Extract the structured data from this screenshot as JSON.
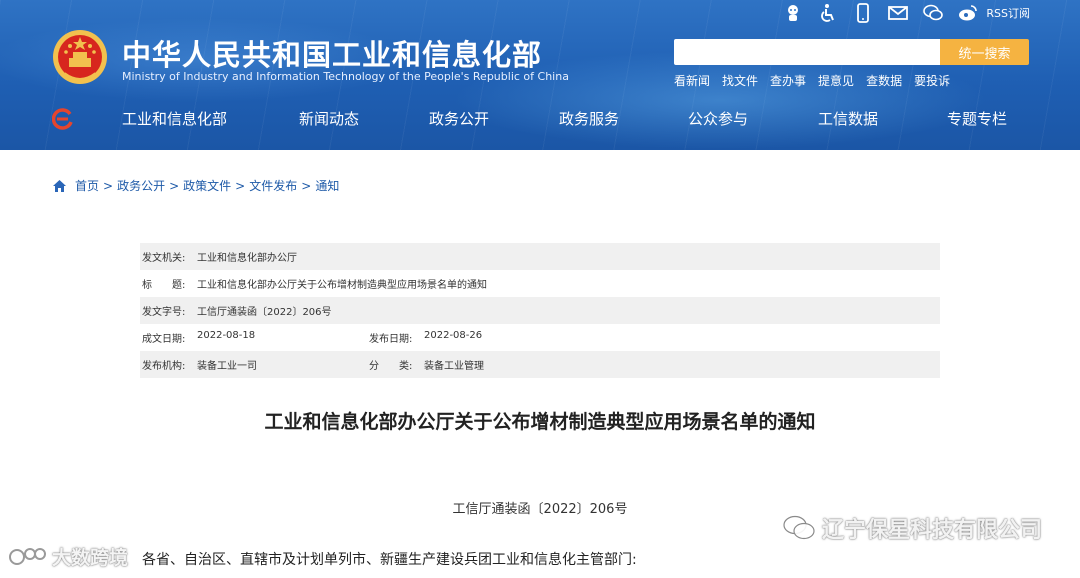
{
  "header": {
    "title": "中华人民共和国工业和信息化部",
    "subtitle": "Ministry of Industry and Information Technology of the People's Republic of China",
    "rss_label": "RSS订阅",
    "util_icons": [
      "robot-icon",
      "accessibility-icon",
      "mobile-icon",
      "mail-icon",
      "wechat-icon",
      "weibo-icon"
    ],
    "search": {
      "placeholder": "",
      "button_label": "统一搜索"
    },
    "quick_links": [
      "看新闻",
      "找文件",
      "查办事",
      "提意见",
      "查数据",
      "要投诉"
    ],
    "nav": [
      "工业和信息化部",
      "新闻动态",
      "政务公开",
      "政务服务",
      "公众参与",
      "工信数据",
      "专题专栏"
    ]
  },
  "breadcrumb": [
    "首页",
    "政务公开",
    "政策文件",
    "文件发布",
    "通知"
  ],
  "breadcrumb_separator": ">",
  "info": {
    "issuer_label": "发文机关:",
    "issuer": "工业和信息化部办公厅",
    "title_label": "标　　题:",
    "title": "工业和信息化部办公厅关于公布增材制造典型应用场景名单的通知",
    "doc_no_label": "发文字号:",
    "doc_no": "工信厅通装函〔2022〕206号",
    "written_label": "成文日期:",
    "written": "2022-08-18",
    "published_label": "发布日期:",
    "published": "2022-08-26",
    "org_label": "发布机构:",
    "org": "装备工业一司",
    "category_label": "分　　类:",
    "category": "装备工业管理"
  },
  "article": {
    "title": "工业和信息化部办公厅关于公布增材制造典型应用场景名单的通知",
    "doc_number": "工信厅通装函〔2022〕206号",
    "addressees": "各省、自治区、直辖市及计划单列市、新疆生产建设兵团工业和信息化主管部门:"
  },
  "watermarks": {
    "right": "辽宁保星科技有限公司",
    "left": "大数跨境"
  },
  "colors": {
    "header_blue": "#1f5fb3",
    "search_button": "#f5b341",
    "link_blue": "#1e5aa8",
    "row_shade": "#f0f0f0"
  }
}
